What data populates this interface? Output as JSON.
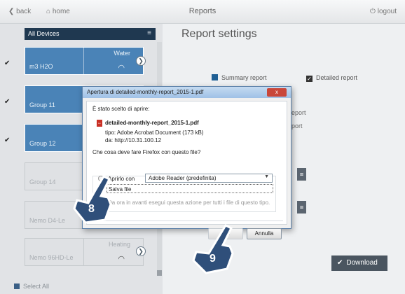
{
  "topbar": {
    "back": "back",
    "home": "home",
    "title": "Reports",
    "logout": "logout"
  },
  "sidebar": {
    "all_devices": "All Devices",
    "menu_glyph": "≡",
    "tiles": [
      {
        "name": "m3 H2O",
        "category": "Water",
        "selected": true,
        "style": "blue"
      },
      {
        "name": "Group 11",
        "category": "",
        "selected": true,
        "style": "blue"
      },
      {
        "name": "Group 12",
        "category": "",
        "selected": true,
        "style": "blue"
      },
      {
        "name": "Group 14",
        "category": "",
        "selected": false,
        "style": "grey"
      },
      {
        "name": "Nemo D4-Le",
        "category": "",
        "selected": false,
        "style": "grey"
      },
      {
        "name": "Nemo 96HD-Le",
        "category": "Heating",
        "selected": false,
        "style": "grey"
      }
    ],
    "select_all": "Select All"
  },
  "main": {
    "title": "Report settings",
    "summary_report": "Summary report",
    "detailed_report": "Detailed report",
    "behind_text_1": "eport",
    "behind_text_2": "port",
    "download": "Download"
  },
  "dialog": {
    "title": "Apertura di detailed-monthly-report_2015-1.pdf",
    "close": "x",
    "intro": "È stato scelto di aprire:",
    "filename": "detailed-monthly-report_2015-1.pdf",
    "type_line": "tipo: Adobe Acrobat Document (173 kB)",
    "from_line": "da: http://10.31.100.12",
    "question": "Che cosa deve fare Firefox con questo file?",
    "open_with_label": "Aprirlo con",
    "open_with_value": "Adobe Reader  (predefinita)",
    "save_file": "Salva file",
    "remember": "Da ora in avanti esegui questa azione per tutti i file di questo tipo.",
    "ok": "OK",
    "cancel": "Annulla"
  },
  "steps": {
    "step_8": "8",
    "step_9": "9"
  },
  "colors": {
    "accent_blue": "#4a83b7",
    "dark_bar": "#1f3850",
    "download_bg": "#4a5560"
  }
}
